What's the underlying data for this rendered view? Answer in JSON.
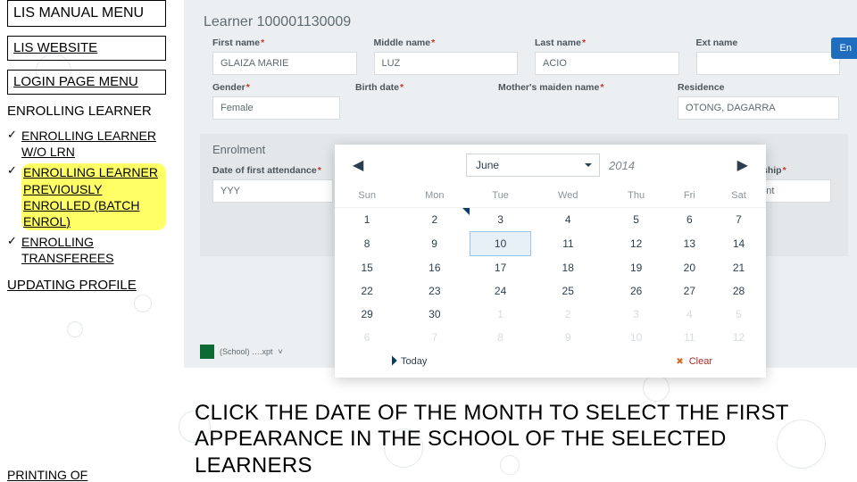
{
  "sidebar": {
    "title": "LIS MANUAL MENU",
    "lis_website": "LIS WEBSITE",
    "login_page": "LOGIN PAGE MENU",
    "enrolling": "ENROLLING LEARNER",
    "items": [
      {
        "label": "ENROLLING LEARNER W/O LRN"
      },
      {
        "label": "ENROLLING LEARNER PREVIOUSLY ENROLLED (BATCH ENROL)",
        "highlight": true
      },
      {
        "label": "ENROLLING TRANSFEREES"
      }
    ],
    "updating": "UPDATING PROFILE",
    "printing": "PRINTING OF"
  },
  "form": {
    "learner_label": "Learner",
    "learner_id": "100001130009",
    "badge": "En",
    "first_name": {
      "label": "First name",
      "value": "GLAIZA MARIE"
    },
    "middle_name": {
      "label": "Middle name",
      "value": "LUZ"
    },
    "last_name": {
      "label": "Last name",
      "value": "ACIO"
    },
    "ext_name": {
      "label": "Ext name",
      "value": ""
    },
    "gender": {
      "label": "Gender",
      "value": "Female"
    },
    "birth": {
      "label": "Birth date"
    },
    "mother": {
      "label": "Mother's maiden name"
    },
    "residence": {
      "label": "Residence",
      "value": "OTONG, DAGARRA"
    },
    "panel_title": "Enrolment",
    "first_attendance": {
      "label": "Date of first attendance",
      "value": "YYY"
    },
    "relationship": {
      "label": "lationship",
      "value": "Parent"
    },
    "xls": "(School) ….xpt"
  },
  "datepicker": {
    "month": "June",
    "year": "2014",
    "dow": [
      "Sun",
      "Mon",
      "Tue",
      "Wed",
      "Thu",
      "Fri",
      "Sat"
    ],
    "rows": [
      [
        "1",
        "2",
        "3",
        "4",
        "5",
        "6",
        "7"
      ],
      [
        "8",
        "9",
        "10",
        "11",
        "12",
        "13",
        "14"
      ],
      [
        "15",
        "16",
        "17",
        "18",
        "19",
        "20",
        "21"
      ],
      [
        "22",
        "23",
        "24",
        "25",
        "26",
        "27",
        "28"
      ],
      [
        "29",
        "30",
        "1",
        "2",
        "3",
        "4",
        "5"
      ],
      [
        "6",
        "7",
        "8",
        "9",
        "10",
        "11",
        "12"
      ]
    ],
    "selected": "10",
    "marked": "2",
    "today": "Today",
    "clear": "Clear"
  },
  "caption": "CLICK THE DATE OF THE MONTH TO SELECT THE FIRST APPEARANCE IN THE SCHOOL OF THE SELECTED LEARNERS"
}
